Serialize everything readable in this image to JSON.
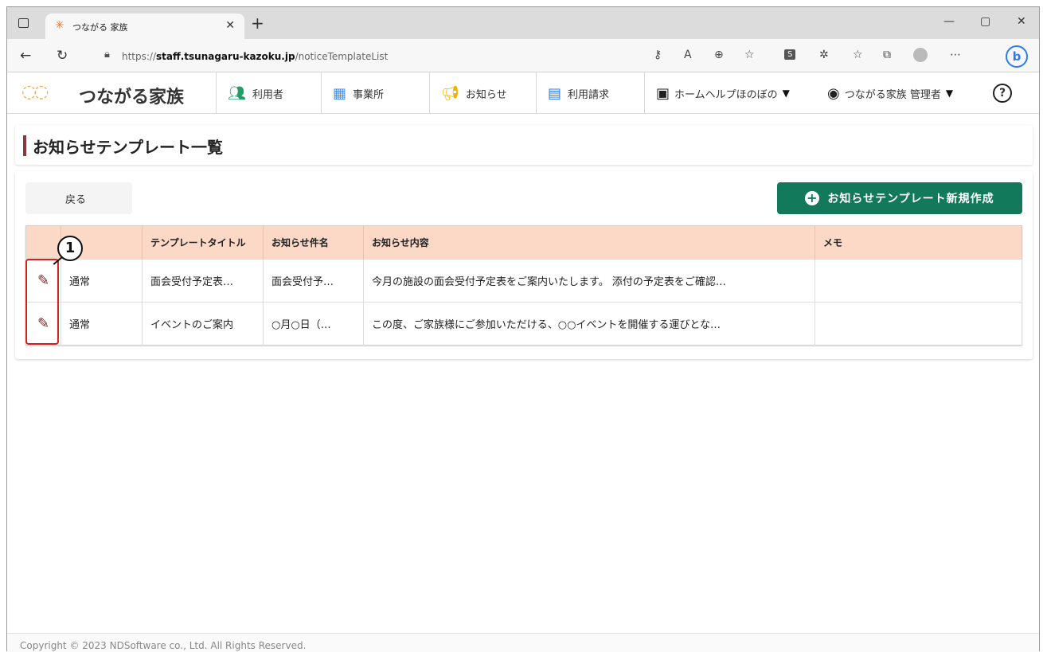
{
  "browser": {
    "tab_title": "つながる 家族",
    "url_prefix": "https://",
    "url_host": "staff.tsunagaru-kazoku.jp",
    "url_path": "/noticeTemplateList",
    "win_min": "—",
    "win_max": "▢",
    "win_close": "✕",
    "bing_label": "b"
  },
  "app": {
    "logo_text": "つながる家族",
    "nav": {
      "users": "利用者",
      "offices": "事業所",
      "notices": "お知らせ",
      "billing": "利用請求",
      "facility": "ホームヘルプほのぼの",
      "account": "つながる家族 管理者",
      "help": "?"
    }
  },
  "page": {
    "title": "お知らせテンプレート一覧",
    "back_label": "戻る",
    "new_label": "お知らせテンプレート新規作成"
  },
  "table": {
    "headers": [
      "",
      "",
      "テンプレートタイトル",
      "お知らせ件名",
      "お知らせ内容",
      "メモ"
    ],
    "rows": [
      {
        "type": "通常",
        "title": "面会受付予定表…",
        "subject": "面会受付予…",
        "content": "今月の施設の面会受付予定表をご案内いたします。 添付の予定表をご確認…",
        "memo": ""
      },
      {
        "type": "通常",
        "title": "イベントのご案内",
        "subject": "○月○日（…",
        "content": "この度、ご家族様にご参加いただける、○○イベントを開催する運びとな…",
        "memo": ""
      }
    ]
  },
  "annotation": {
    "number": "1"
  },
  "footer": {
    "copyright": "Copyright © 2023 NDSoftware co., Ltd. All Rights Reserved."
  },
  "colors": {
    "accent": "#127a5a",
    "header_bg": "#fbd9c6",
    "annotation": "#d61f1f",
    "title_bar": "#8a3a3a"
  }
}
